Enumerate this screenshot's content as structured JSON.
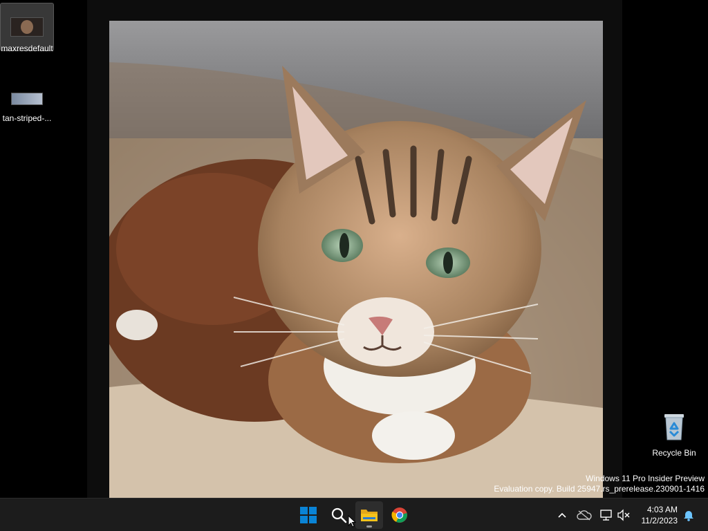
{
  "desktop": {
    "icons": [
      {
        "label": "maxresdefault",
        "selected": true
      },
      {
        "label": "tan-striped-..."
      },
      {
        "label": "Recycle Bin"
      }
    ],
    "watermark": {
      "line1": "Windows 11 Pro Insider Preview",
      "line2": "Evaluation copy. Build 25947.rs_prerelease.230901-1416"
    }
  },
  "taskbar": {
    "apps": [
      {
        "name": "start-icon"
      },
      {
        "name": "search-icon"
      },
      {
        "name": "file-explorer-icon",
        "active": true
      },
      {
        "name": "chrome-icon"
      }
    ],
    "tray": {
      "icons": [
        "chevron-up-icon",
        "onedrive-icon",
        "network-icon",
        "volume-muted-icon",
        "notification-bell-icon"
      ],
      "time": "4:03 AM",
      "date": "11/2/2023"
    }
  },
  "colors": {
    "taskbar_bg": "#1c1c1c",
    "start_blue": "#0a84d6",
    "folder_yellow": "#f4c21c"
  }
}
